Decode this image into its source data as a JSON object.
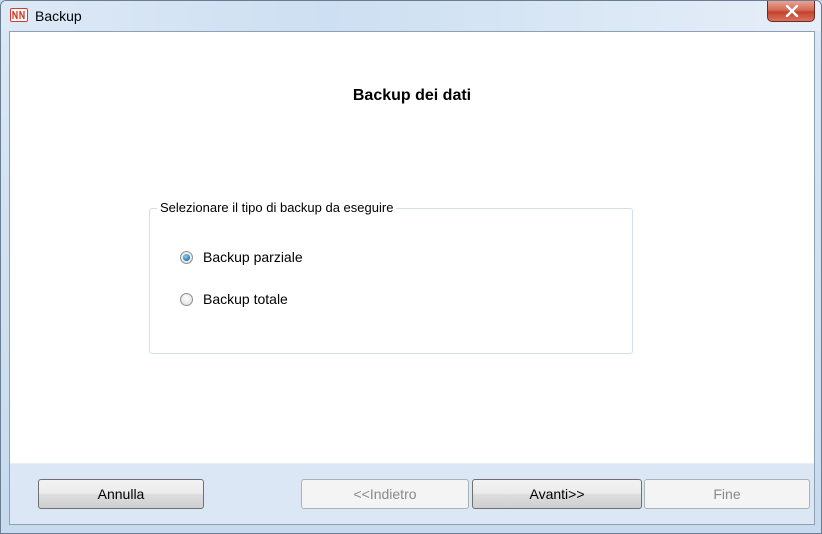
{
  "window": {
    "title": "Backup",
    "accent_color": "#d63a2a",
    "close_icon": "close-icon"
  },
  "main": {
    "heading": "Backup dei dati",
    "group": {
      "label": "Selezionare il tipo di backup da eseguire",
      "options": [
        {
          "label": "Backup parziale",
          "checked": true
        },
        {
          "label": "Backup totale",
          "checked": false
        }
      ]
    }
  },
  "footer": {
    "cancel_label": "Annulla",
    "back_label": "<<Indietro",
    "back_enabled": false,
    "next_label": "Avanti>>",
    "finish_label": "Fine",
    "finish_enabled": false
  }
}
